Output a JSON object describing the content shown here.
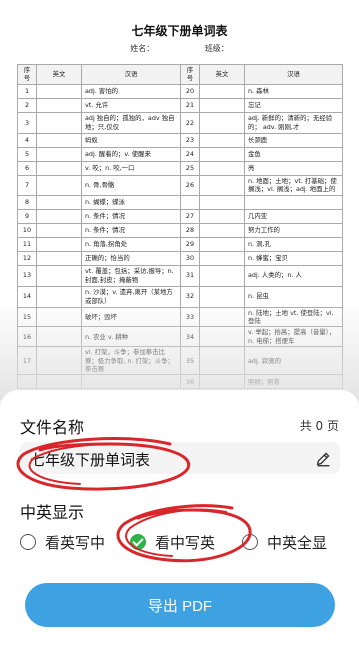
{
  "document": {
    "title": "七年级下册单词表",
    "name_label": "姓名：",
    "class_label": "班级：",
    "headers": [
      "序号",
      "英文",
      "汉语",
      "序号",
      "英文",
      "汉语"
    ],
    "rows": [
      {
        "n1": "1",
        "c1": "adj. 害怕的",
        "n2": "20",
        "c2": "n. 森林"
      },
      {
        "n1": "2",
        "c1": "vt. 允许",
        "n2": "21",
        "c2": "忘记"
      },
      {
        "n1": "3",
        "c1": "adj 独自的；孤独的，adv 独自地；只,仅仅",
        "n2": "22",
        "c2": "adj. 新鲜的；清新的；无经验的； adv. 刚刚,才"
      },
      {
        "n1": "4",
        "c1": "蚂蚁",
        "n2": "23",
        "c2": "长颈鹿"
      },
      {
        "n1": "5",
        "c1": "adj. 醒着的；v. 使醒来",
        "n2": "24",
        "c2": "金鱼"
      },
      {
        "n1": "6",
        "c1": "v. 咬；n. 咬,一口",
        "n2": "25",
        "c2": "亮"
      },
      {
        "n1": "7",
        "c1": "n. 骨,骨骼",
        "n2": "26",
        "c2": "n. 地面；土地；vt. 打基础；使搁浅；vi. 搁浅；adj. 地面上的"
      },
      {
        "n1": "8",
        "c1": "n. 蝴蝶；蝶泳",
        "n2": "",
        "c2": ""
      },
      {
        "n1": "9",
        "c1": "n. 条件；情况",
        "n2": "27",
        "c2": "几内亚"
      },
      {
        "n1": "10",
        "c1": "n. 条件；情况",
        "n2": "28",
        "c2": "努力工作的"
      },
      {
        "n1": "11",
        "c1": "n. 角落,拐角处",
        "n2": "29",
        "c2": "n. 洞,孔"
      },
      {
        "n1": "12",
        "c1": "正确的；恰当的",
        "n2": "30",
        "c2": "n. 蜂蜜；宝贝"
      },
      {
        "n1": "13",
        "c1": "vt. 覆盖；包括；采访,报导；n. 封面,封皮；掩蔽物",
        "n2": "31",
        "c2": "adj. 人类的；n. 人"
      },
      {
        "n1": "14",
        "c1": "n. 沙漠；v. 遗弃,离开（某地方或部队）",
        "n2": "32",
        "c2": "n. 昆虫"
      },
      {
        "n1": "15",
        "c1": "破坏；毁坏",
        "n2": "33",
        "c2": "n. 陆地；土地 vt. 使登陆；vi. 登陆"
      },
      {
        "n1": "16",
        "c1": "n. 农业 v. 耕种",
        "n2": "34",
        "c2": "v. 举起；抬高；提高（音量），n. 电梯；搭便车"
      },
      {
        "n1": "17",
        "c1": "vi. 打架，斗争；参加拳击比赛；极力争取, n. 打架；斗争；拳击赛",
        "n2": "35",
        "c2": "adj. 寂寞的"
      },
      {
        "n1": "",
        "c1": "",
        "n2": "36",
        "c2": "照顾；照看"
      }
    ]
  },
  "sheet": {
    "file_name_label": "文件名称",
    "page_count": "共 0 页",
    "file_name_value": "七年级下册单词表",
    "mode_label": "中英显示",
    "options": [
      "看英写中",
      "看中写英",
      "中英全显"
    ],
    "selected_option": "看中写英",
    "export_label": "导出 PDF"
  },
  "colors": {
    "accent": "#3ea1e1",
    "selected": "#2eb34a",
    "annotation": "#d9262b"
  },
  "icons": {
    "edit": "pencil-icon",
    "check": "check-icon"
  }
}
